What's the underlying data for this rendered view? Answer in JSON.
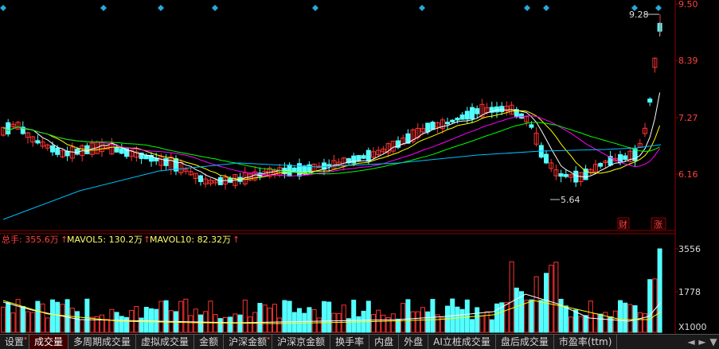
{
  "price_axis": {
    "labels": [
      "9.50",
      "8.39",
      "7.27",
      "6.16"
    ]
  },
  "annotations": {
    "high": "9.28",
    "low": "5.64",
    "badge_fin": "财",
    "badge_surge": "涨"
  },
  "volume_legend": {
    "total_label": "总手: 355.6万",
    "mavol5_label": "MAVOL5: 130.2万",
    "mavol10_label": "MAVOL10: 82.32万"
  },
  "volume_axis": {
    "labels": [
      "3556",
      "1778"
    ],
    "unit": "X1000"
  },
  "tabs": [
    {
      "label": "设置",
      "dot": true
    },
    {
      "label": "成交量",
      "dot": false,
      "active": true
    },
    {
      "label": "多周期成交量",
      "dot": false
    },
    {
      "label": "虚拟成交量",
      "dot": false
    },
    {
      "label": "金额",
      "dot": false
    },
    {
      "label": "沪深金额",
      "dot": true
    },
    {
      "label": "沪深京金额",
      "dot": false
    },
    {
      "label": "换手率",
      "dot": false
    },
    {
      "label": "内盘",
      "dot": false
    },
    {
      "label": "外盘",
      "dot": false
    },
    {
      "label": "AI立桩成交量",
      "dot": false
    },
    {
      "label": "盘后成交量",
      "dot": false
    },
    {
      "label": "市盈率(ttm)",
      "dot": false
    }
  ],
  "nav_arrows": [
    "◄",
    "►",
    "▼"
  ],
  "colors": {
    "up": "#ff3232",
    "down": "#54ffff",
    "ma5": "#ffffff",
    "ma10": "#ffff00",
    "ma20": "#ff00ff",
    "ma30": "#00ff00",
    "ma60": "#00bfff",
    "grid": "#8b0000"
  }
}
